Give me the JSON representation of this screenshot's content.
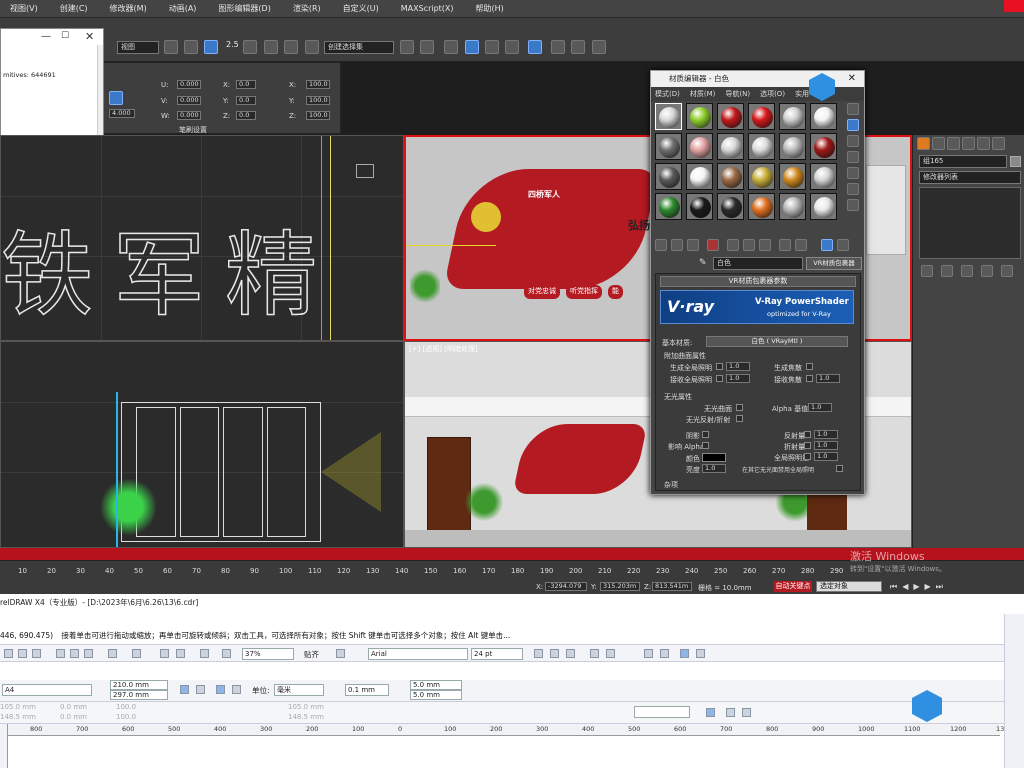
{
  "max": {
    "menu": [
      "视图(V)",
      "创建(C)",
      "修改器(M)",
      "动画(A)",
      "图形编辑器(D)",
      "渲染(R)",
      "自定义(U)",
      "MAXScript(X)",
      "帮助(H)"
    ],
    "view_dropdown": "视图",
    "selection_set_dropdown": "创建选择集",
    "snap_num": "2.5",
    "stats": "mitives: 644691",
    "brush_settings": "笔刷设置",
    "transform": {
      "u": "0.000",
      "v": "0.000",
      "w": "0.000",
      "x": "0.0",
      "y": "0.0",
      "z": "0.0",
      "sx": "100.0",
      "sy": "100.0",
      "sz": "100.0",
      "extra": "4.000"
    },
    "viewport_labels": {
      "perspective": "[+] [透视] [明暗处理]"
    },
    "scene_text": {
      "banner_title": "四桥军人",
      "slogan1": "对党忠诚",
      "slogan2": "听党指挥",
      "slogan3": "能",
      "side_text": "弘扬",
      "big_text_chars": [
        "铁",
        "军",
        "精"
      ]
    },
    "timeline_ticks": [
      "10",
      "20",
      "30",
      "40",
      "50",
      "60",
      "70",
      "80",
      "90",
      "100",
      "110",
      "120",
      "130",
      "140",
      "150",
      "160",
      "170",
      "180",
      "190",
      "200",
      "210",
      "220",
      "230",
      "240",
      "250",
      "260",
      "270",
      "280",
      "290"
    ],
    "status": {
      "x": "-3294.079",
      "y": "315.203m",
      "z": "813.541m",
      "grid": "栅格 = 10.0mm",
      "auto_key": "自动关键点",
      "selected": "选定对象",
      "activate": "激活 Windows",
      "activate_sub": "转到\"设置\"以激活 Windows。"
    },
    "command_panel": {
      "object_name": "组165",
      "modifier_list": "修改器列表"
    },
    "material_editor": {
      "title": "材质编辑器 - 白色",
      "menu": [
        "模式(D)",
        "材质(M)",
        "导航(N)",
        "选项(O)",
        "实用"
      ],
      "material_name": "白色",
      "material_type": "VR材质包裹器",
      "rollout_title": "VR材质包裹器参数",
      "vray_logo": "V·ray",
      "powershader_title": "V-Ray PowerShader",
      "powershader_sub": "optimized for V-Ray",
      "base_material_label": "基本材质:",
      "base_material_value": "白色 ( VRayMtl )",
      "surface_props": "附加曲面属性",
      "gen_gi": "生成全局照明",
      "gen_caustics": "生成焦散",
      "recv_gi": "接收全局照明",
      "recv_caustics": "接收焦散",
      "val_gen_gi": "1.0",
      "val_gen_caustics": "1.0",
      "val_recv_gi": "1.0",
      "val_recv_caustics": "1.0",
      "matte_props": "无光属性",
      "matte_surface": "无光曲面",
      "alpha_contrib": "Alpha 基值",
      "alpha_val": "1.0",
      "matte_refl": "无光反射/折射",
      "shadows": "阴影",
      "affect_alpha": "影响 Alpha",
      "color": "颜色",
      "brightness": "亮度",
      "brightness_val": "1.0",
      "reflection_amount": "反射量",
      "refraction_amount": "折射量",
      "gi_amount": "全局照明量",
      "refl_val": "1.0",
      "refr_val": "1.0",
      "gi_val": "1.0",
      "no_gi_other": "在其它无光面禁用全局照明",
      "misc": "杂项",
      "sphere_colors": [
        "#d8d8d8",
        "#8fcf2a",
        "#c01a1a",
        "#d51919",
        "#cfcfcf",
        "#f2f2f2",
        "#707070",
        "#e3a2a2",
        "#d8d8d8",
        "#dcdcdc",
        "#bcbcbc",
        "#a01818",
        "#5a5a5a",
        "#f5f5f5",
        "#9b6a45",
        "#c9b03a",
        "#d28a20",
        "#d5d5d5",
        "#2e8a2e",
        "#1a1a1a",
        "#2b2b2b",
        "#e07020",
        "#b8b8b8",
        "#e8e8e8"
      ]
    }
  },
  "corel": {
    "title": "relDRAW X4（专业版）- [D:\\2023年\\6月\\6.26\\13\\6.cdr]",
    "hint_coords": "446, 690.475)",
    "hint": "接着单击可进行拖动或缩放；再单击可旋转或倾斜；双击工具，可选择所有对象；按住 Shift 键单击可选择多个对象；按住 Alt 键单击...",
    "zoom": "37%",
    "snap": "贴齐",
    "font": "Arial",
    "font_size": "24 pt",
    "paper": "A4",
    "width": "210.0 mm",
    "height": "297.0 mm",
    "units_label": "单位:",
    "units": "毫米",
    "nudge": "0.1 mm",
    "dup_x": "5.0 mm",
    "dup_y": "5.0 mm",
    "pos_x": "105.0 mm",
    "pos_y": "148.5 mm",
    "zero_x": "0.0 mm",
    "zero_y": "0.0 mm",
    "scale_x": "100.0",
    "scale_y": "100.0",
    "pos_x2": "105.0 mm",
    "pos_y2": "148.5 mm",
    "ruler": [
      "800",
      "700",
      "600",
      "500",
      "400",
      "300",
      "200",
      "100",
      "0",
      "100",
      "200",
      "300",
      "400",
      "500",
      "600",
      "700",
      "800",
      "900",
      "1000",
      "1100",
      "1200",
      "1300"
    ]
  }
}
